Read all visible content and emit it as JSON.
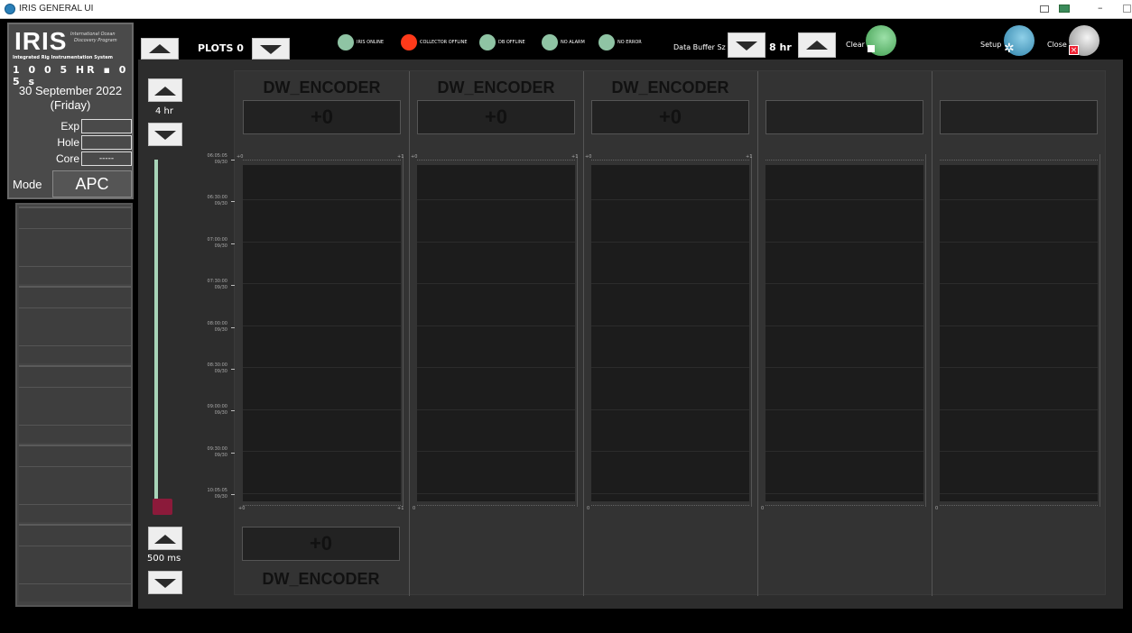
{
  "window": {
    "title": "IRIS GENERAL UI"
  },
  "logo": {
    "text": "IRIS",
    "sub1": "International Ocean",
    "sub2": "Discovery Program",
    "sub3": "Integrated Rig Instrumentation System"
  },
  "clock": {
    "text": "1 0 0 5 HR ▪ 0 5 s"
  },
  "date": {
    "date": "30 September 2022",
    "day": "(Friday)"
  },
  "fields": [
    {
      "label": "Exp",
      "value": ""
    },
    {
      "label": "Hole",
      "value": ""
    },
    {
      "label": "Core",
      "value": "-----"
    }
  ],
  "mode": {
    "label": "Mode",
    "value": "APC"
  },
  "toolbar": {
    "plots_label": "PLOTS 0",
    "indicators": [
      {
        "label": "IRIS ONLINE",
        "color": "#8fc4a4"
      },
      {
        "label": "COLLECTOR OFFLINE",
        "color": "#ff3a1a"
      },
      {
        "label": "DB OFFLINE",
        "color": "#8fc4a4"
      },
      {
        "label": "NO ALARM",
        "color": "#8fc4a4"
      },
      {
        "label": "NO ERROR",
        "color": "#8fc4a4"
      }
    ],
    "buffer_label": "Data Buffer Sz",
    "buffer_value": "8 hr",
    "clear_label": "Clear",
    "setup_label": "Setup",
    "close_label": "Close"
  },
  "time_span": {
    "value": "4 hr"
  },
  "refresh_rate": {
    "value": "500 ms"
  },
  "time_axis": [
    {
      "time": "06:05:05",
      "date": "09/30"
    },
    {
      "time": "06:30:00",
      "date": "09/30"
    },
    {
      "time": "07:00:00",
      "date": "09/30"
    },
    {
      "time": "07:30:00",
      "date": "09/30"
    },
    {
      "time": "08:00:00",
      "date": "09/30"
    },
    {
      "time": "08:30:00",
      "date": "09/30"
    },
    {
      "time": "09:00:00",
      "date": "09/30"
    },
    {
      "time": "09:30:00",
      "date": "09/30"
    },
    {
      "time": "10:05:05",
      "date": "09/30"
    }
  ],
  "plots": [
    {
      "title": "DW_ENCODER",
      "value": "+0",
      "scale_min": "+0",
      "scale_max": "+1",
      "bottom_min": "+0",
      "bottom_max": "+1"
    },
    {
      "title": "DW_ENCODER",
      "value": "+0",
      "scale_min": "+0",
      "scale_max": "+1",
      "bottom_min": "0",
      "bottom_max": ""
    },
    {
      "title": "DW_ENCODER",
      "value": "+0",
      "scale_min": "+0",
      "scale_max": "+1",
      "bottom_min": "0",
      "bottom_max": ""
    },
    {
      "title": "",
      "value": "",
      "scale_min": "",
      "scale_max": "",
      "bottom_min": "0",
      "bottom_max": ""
    },
    {
      "title": "",
      "value": "",
      "scale_min": "",
      "scale_max": "",
      "bottom_min": "0",
      "bottom_max": ""
    }
  ],
  "bottom_plot": {
    "title": "DW_ENCODER",
    "value": "+0"
  }
}
